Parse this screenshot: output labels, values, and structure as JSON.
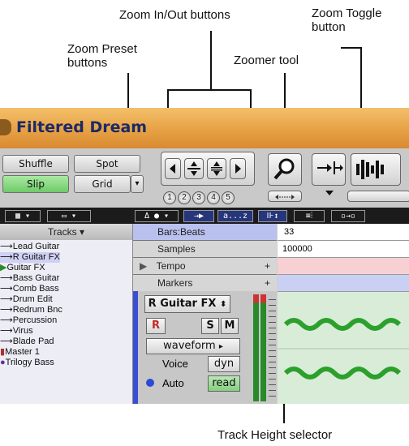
{
  "callouts": {
    "zoom_inout": "Zoom In/Out buttons",
    "zoom_toggle": "Zoom Toggle\nbutton",
    "zoom_preset": "Zoom Preset\nbuttons",
    "zoomer": "Zoomer tool",
    "track_height": "Track Height selector"
  },
  "window": {
    "title": "Filtered Dream"
  },
  "edit_modes": {
    "shuffle": "Shuffle",
    "spot": "Spot",
    "slip": "Slip",
    "grid": "Grid"
  },
  "zoom_presets": [
    "1",
    "2",
    "3",
    "4",
    "5"
  ],
  "toolbar_strip": [
    "a...z"
  ],
  "tracks": {
    "header": "Tracks",
    "items": [
      "Lead Guitar",
      "R Guitar FX",
      "Guitar FX",
      "Bass Guitar",
      "Comb Bass",
      "Drum Edit",
      "Redrum Bnc",
      "Percussion",
      "Virus",
      "Blade Pad",
      "Master 1",
      "Trilogy Bass"
    ]
  },
  "rulers": {
    "bars_beats": "Bars:Beats",
    "samples": "Samples",
    "tempo": "Tempo",
    "markers": "Markers",
    "add": "+"
  },
  "timeline": {
    "bar": "33",
    "samples": "100000"
  },
  "track": {
    "name": "R Guitar FX",
    "rec": "R",
    "solo": "S",
    "mute": "M",
    "view": "waveform",
    "voice_label": "Voice",
    "voice_value": "dyn",
    "auto_label": "Auto",
    "auto_value": "read"
  },
  "colors": {
    "title_bg": "#e7a145",
    "title_text": "#1a2a66",
    "mode_on": "#6fca68",
    "waveform": "#2ca02c",
    "ruler_blue": "#b9c1ee",
    "tempo_pink": "#f7d0d3"
  }
}
